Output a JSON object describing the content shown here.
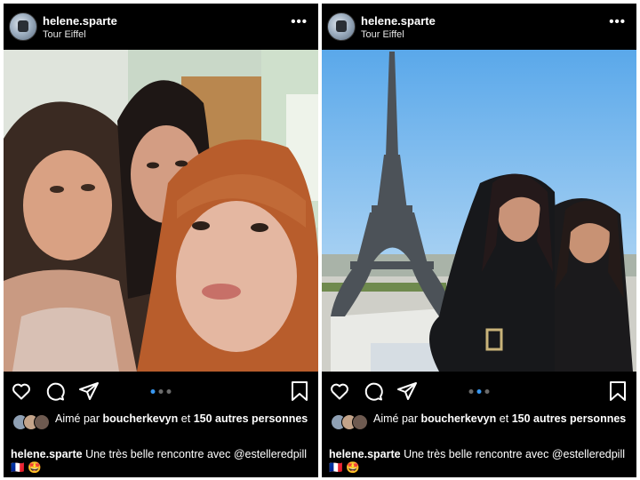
{
  "posts": [
    {
      "username": "helene.sparte",
      "location": "Tour Eiffel",
      "more": "•••",
      "photo_subject": "selfie-three-women",
      "carousel": {
        "count": 3,
        "active_index": 0
      },
      "likes": {
        "prefix": "Aimé par",
        "user": "boucherkevyn",
        "connector": "et",
        "count": "150 autres",
        "suffix": "personnes"
      },
      "caption": {
        "username": "helene.sparte",
        "text": "Une très belle rencontre avec",
        "mention": "@estelleredpill",
        "emojis": "🇫🇷 🤩"
      }
    },
    {
      "username": "helene.sparte",
      "location": "Tour Eiffel",
      "more": "•••",
      "photo_subject": "eiffel-tower-two-women",
      "carousel": {
        "count": 3,
        "active_index": 1
      },
      "likes": {
        "prefix": "Aimé par",
        "user": "boucherkevyn",
        "connector": "et",
        "count": "150 autres",
        "suffix": "personnes"
      },
      "caption": {
        "username": "helene.sparte",
        "text": "Une très belle rencontre avec",
        "mention": "@estelleredpill",
        "emojis": "🇫🇷 🤩"
      }
    }
  ],
  "icons": [
    "heart-icon",
    "comment-icon",
    "share-icon",
    "bookmark-icon",
    "more-options-icon"
  ],
  "colors": {
    "background": "#000000",
    "text": "#ffffff",
    "dot_active": "#3897f0",
    "dot_inactive": "#6b6b6b"
  }
}
